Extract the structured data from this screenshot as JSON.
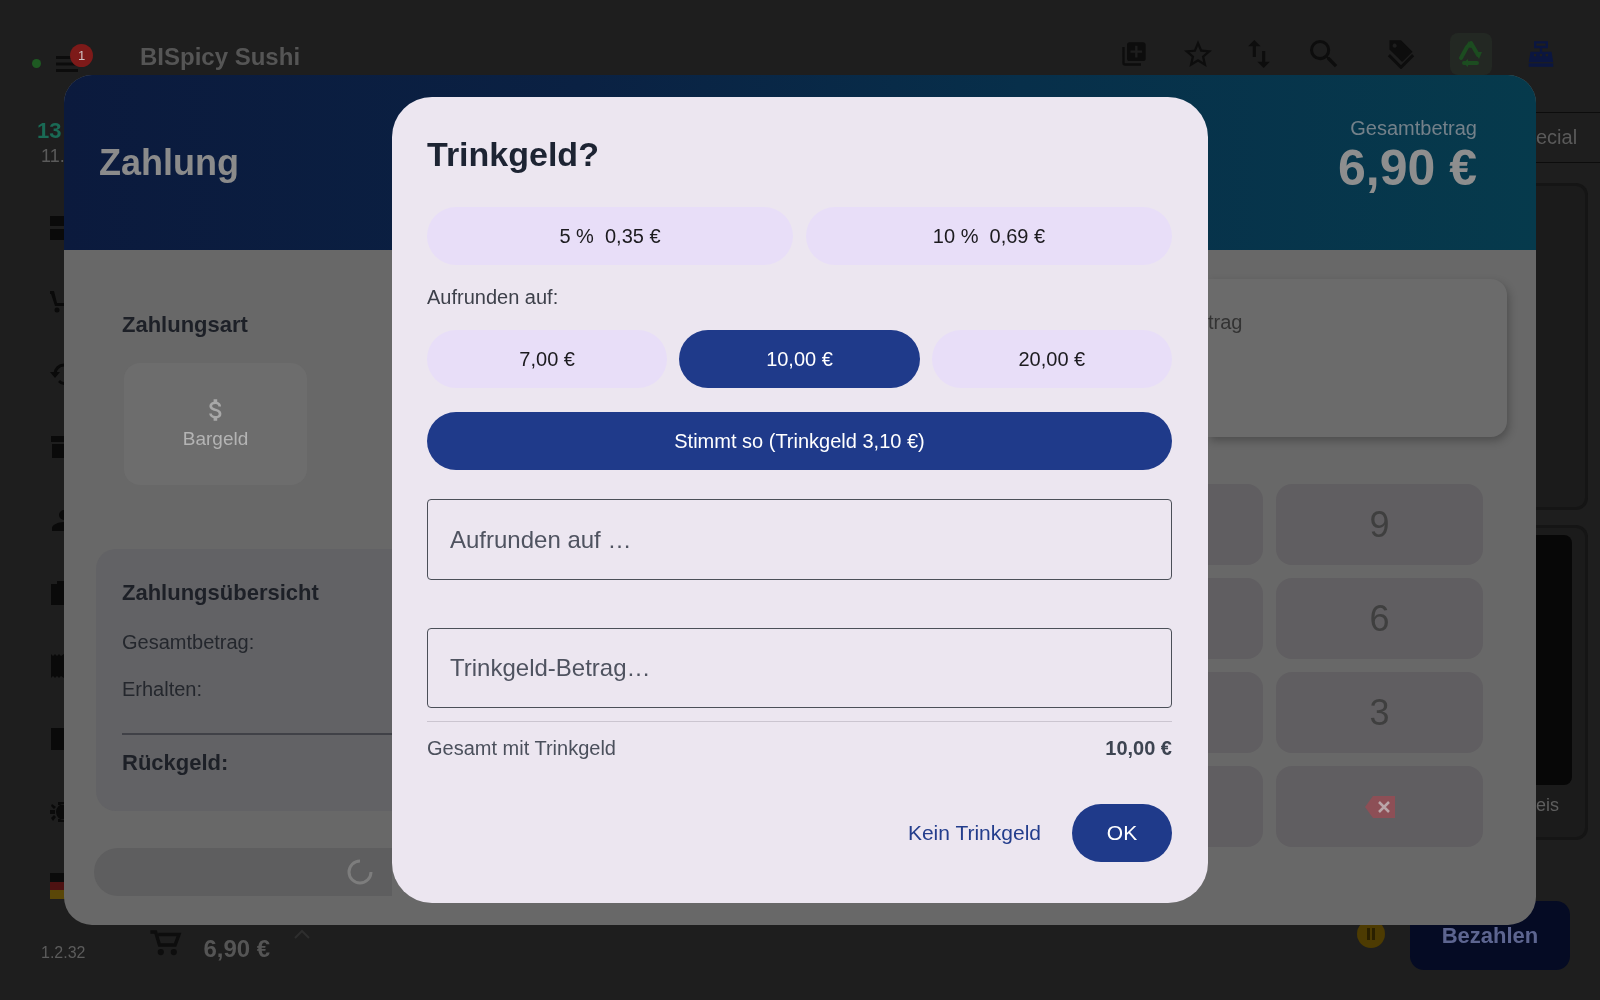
{
  "app_bar": {
    "connection": {
      "online": true
    },
    "menu_badge": "1",
    "title": "BISpicy Sushi"
  },
  "sidebar": {
    "time": "13",
    "date": "11.",
    "version": "1.2.32"
  },
  "category_tab": {
    "label": "ecial"
  },
  "product_card": {
    "label": "eis"
  },
  "cart_bar": {
    "total": "6,90 €",
    "pay_button": "Bezahlen"
  },
  "payment_dialog": {
    "title": "Zahlung",
    "total_label": "Gesamtbetrag",
    "total": "6,90 €",
    "payment_method_heading": "Zahlungsart",
    "payment_methods": [
      {
        "label": "Bargeld",
        "disabled": true
      }
    ],
    "summary": {
      "heading": "Zahlungsübersicht",
      "rows": [
        "Gesamtbetrag:",
        "Erhalten:"
      ],
      "change_label": "Rückgeld:"
    },
    "confirm_button": {
      "busy": true
    },
    "amount_card": {
      "label": "trag"
    },
    "keypad": [
      {
        "kind": "digit",
        "label": "9"
      },
      {
        "kind": "digit",
        "label": "6"
      },
      {
        "kind": "digit",
        "label": "3"
      },
      {
        "kind": "backspace"
      }
    ]
  },
  "tip_dialog": {
    "title": "Trinkgeld?",
    "percent_options": [
      {
        "label": "5 %  0,35 €",
        "selected": false
      },
      {
        "label": "10 %  0,69 €",
        "selected": false
      }
    ],
    "round_up_label": "Aufrunden auf:",
    "round_up_options": [
      {
        "label": "7,00 €",
        "selected": false
      },
      {
        "label": "10,00 €",
        "selected": true
      },
      {
        "label": "20,00 €",
        "selected": false
      }
    ],
    "keep_change_button": "Stimmt so (Trinkgeld 3,10 €)",
    "round_up_field": {
      "placeholder": "Aufrunden auf …"
    },
    "tip_amount_field": {
      "placeholder": "Trinkgeld-Betrag…"
    },
    "total_label": "Gesamt mit Trinkgeld",
    "total": "10,00 €",
    "actions": [
      {
        "label": "Kein Trinkgeld",
        "kind": "text"
      },
      {
        "label": "OK",
        "kind": "filled"
      }
    ]
  }
}
